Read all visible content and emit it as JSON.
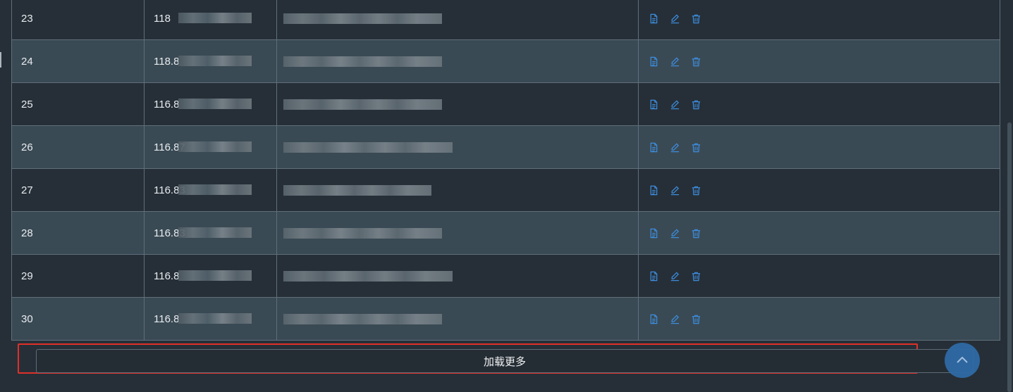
{
  "table": {
    "rows": [
      {
        "index": "23",
        "ip": "118"
      },
      {
        "index": "24",
        "ip": "118.8"
      },
      {
        "index": "25",
        "ip": "116.8"
      },
      {
        "index": "26",
        "ip": "116.87"
      },
      {
        "index": "27",
        "ip": "116.83"
      },
      {
        "index": "28",
        "ip": "116.83"
      },
      {
        "index": "29",
        "ip": "116.8"
      },
      {
        "index": "30",
        "ip": "116.8"
      }
    ],
    "action_icons": [
      "document-icon",
      "edit-icon",
      "trash-icon"
    ],
    "colors": {
      "row_dark": "#262f37",
      "row_light": "#3a4a54",
      "icon": "#3d8ee0",
      "border": "#5f6f7b"
    }
  },
  "load_more": {
    "label": "加载更多",
    "highlight_color": "#e0302a"
  },
  "back_to_top": {
    "icon": "chevron-up-icon",
    "color": "#2f6aa5"
  }
}
